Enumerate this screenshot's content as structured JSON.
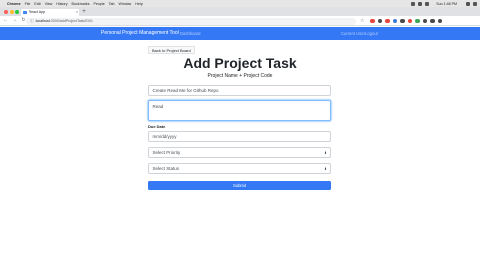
{
  "mac_menu": {
    "app_name": "Chrome",
    "items": [
      "File",
      "Edit",
      "View",
      "History",
      "Bookmarks",
      "People",
      "Tab",
      "Window",
      "Help"
    ],
    "clock": "Sun 1:48 PM"
  },
  "browser": {
    "tab_title": "React App",
    "tab_close": "×",
    "new_tab": "+",
    "url_host": "localhost",
    "url_path": ":3000/addProjectTask/ID01",
    "nav_back": "←",
    "nav_forward": "→",
    "nav_reload": "↻",
    "lock": "ⓘ",
    "star": "☆",
    "extension_colors": [
      "#e8453c",
      "#4a4a4a",
      "#e8453c",
      "#3a7bd5",
      "#4a4a4a",
      "#e8453c",
      "#3aa757",
      "#4a4a4a",
      "#4a4a4a",
      "#4a4a4a"
    ]
  },
  "navbar": {
    "brand": "Personal Project Management Tool",
    "dashboard": "Dashboard",
    "user": "Current User",
    "logout": "Logout",
    "color": "#3478f6"
  },
  "page": {
    "back_button": "Back to Project Board",
    "title": "Add Project Task",
    "subtitle": "Project Name + Project Code"
  },
  "form": {
    "summary_value": "Create Read Me for Github Repo",
    "acceptance_value": "Read",
    "due_date_label": "Due Date",
    "due_date_placeholder": "mm/dd/yyyy",
    "priority_selected": "Select Priority",
    "status_selected": "Select Status",
    "submit_label": "Submit",
    "select_arrow": "⬍"
  }
}
